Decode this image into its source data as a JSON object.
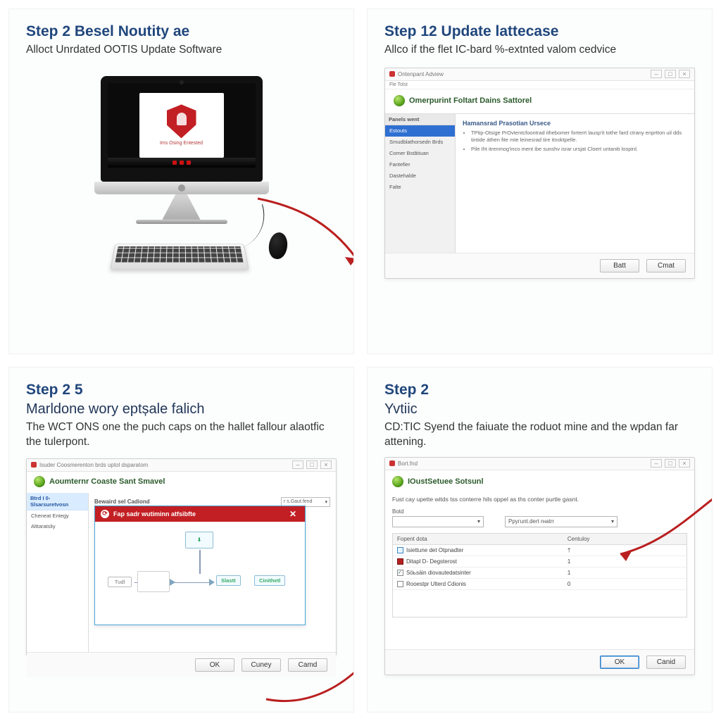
{
  "panel1": {
    "step": "Step 2 Besel Noutity ae",
    "subtitle": "Alloct Unrdated OOTIS Update Software",
    "monitor_caption": "Ims Osing Entested"
  },
  "panel2": {
    "step": "Step 12 Update lattecase",
    "subtitle": "Allco if the flet IC-bard %-extnted valom cedvice",
    "win_title": "Ontenpant Adview",
    "menu": "Fle   Tolst",
    "heading": "Omerpurint Foltart Dains Sattorel",
    "side_header": "Panels went",
    "side_items": [
      "Estouts",
      "Smudblathorsedn Brds",
      "Comer Bstătiuan",
      "Fantefier",
      "Dastehalde",
      "Falte"
    ],
    "content_title": "Hamansrad Prasotian Ursece",
    "bullets": [
      "TPtip-Otsige PrOvtentcfoontrad ithebomer forterrt lausp'it tothe fard ctrany enprtton uil dds tintide áthen fite mte leinesrad tire itnoktpelle.",
      "Pile Iht itrenmog'inco ment ibe sunshv israr ursjat Cloert untaniti lospinl."
    ],
    "btn_back": "Batt",
    "btn_cancel": "Cmat"
  },
  "panel3": {
    "step": "Step 2 5",
    "subtitle": "Marldone wory eptșale falich",
    "desc": "The WCT ONS one the puch caps on the hallet fallour alaotfic the tulerpont.",
    "win_title": "Isuder  Coosmerenton brds uptol dsparatom",
    "heading": "Aoumternr Coaste Sant Smavel",
    "side_header": "Btrd I 0-Slsarsuretvosn",
    "side_items": [
      "Cheneat Entegy",
      "Alttaratsliy"
    ],
    "right_label": "Bewaird sel Cadiond",
    "combo": "r   s.Gaut.fend",
    "overlay_title": "Fap sadr wutiminn atfsibfte",
    "node_top": "⬇",
    "node_left": "Tudl",
    "node_mid": "Slastt",
    "node_right": "Cinithetl",
    "btn_ok": "OK",
    "btn_cancel": "Cuney",
    "btn_cancel2": "Camd"
  },
  "panel4": {
    "step": "Step 2",
    "subtitle": "Yvtiic",
    "desc": "CD:TIC Syend the faiuate the roduot mine and the wpdan far attening.",
    "win_title": "Bort.fnd",
    "heading": "IOustSetuee Sotsunl",
    "intro": "Fust cay upette witds tss conterre hils oppel as ths conter purtle gasnt.",
    "combo1_label": "Botd",
    "combo1_value": "",
    "combo2_value": "Pругunt.dert rнatrr",
    "th1": "Fopent dota",
    "th2": "Centuloy",
    "rows": [
      {
        "chk": "blue",
        "c1": "Isiettune det Otpnadter",
        "c2": "†"
      },
      {
        "chk": "red",
        "c1": "Ditapl D- Degsterost",
        "c2": "1"
      },
      {
        "chk": "chkd",
        "c1": "Söьsäin diovautedatsinter",
        "c2": "1"
      },
      {
        "chk": "",
        "c1": "Rooestpr Ulterd Cdionis",
        "c2": "0"
      }
    ],
    "btn_ok": "OK",
    "btn_cancel": "Canid"
  }
}
